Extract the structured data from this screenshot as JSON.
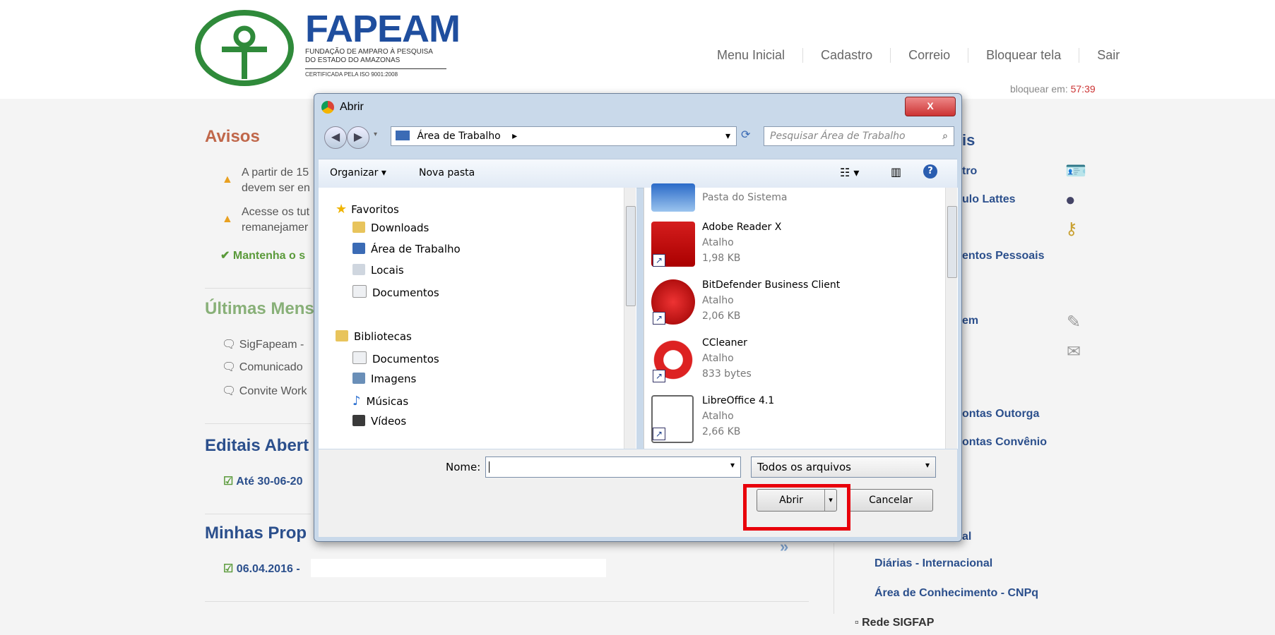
{
  "header": {
    "logo": {
      "title": "FAPEAM",
      "subtitle_line1": "FUNDAÇÃO DE AMPARO À PESQUISA",
      "subtitle_line2": "DO ESTADO DO AMAZONAS",
      "cert": "CERTIFICADA PELA ISO 9001:2008"
    },
    "nav": [
      "Menu Inicial",
      "Cadastro",
      "Correio",
      "Bloquear tela",
      "Sair"
    ],
    "timer_prefix": "bloquear em: ",
    "timer_value": "57:39"
  },
  "left": {
    "avisos_title": "Avisos",
    "avisos": [
      {
        "line1": "A partir de 15",
        "line2": "devem ser en"
      },
      {
        "line1": "Acesse os tut",
        "line2": "remanejamer"
      }
    ],
    "avisos_check": "Mantenha o s",
    "mensagens_title": "Últimas Mens",
    "mensagens": [
      "SigFapeam -",
      "Comunicado",
      "Convite Work"
    ],
    "editais_title": "Editais Abert",
    "editais_item": "Até 30-06-20",
    "propostas_title": "Minhas Prop",
    "propostas_item": "06.04.2016 -"
  },
  "right": {
    "title_fragment": "is",
    "links": [
      "tro",
      "ulo Lattes",
      "entos Pessoais",
      "em",
      "ontas Outorga",
      "ontas Convênio",
      "al",
      "Diárias - Internacional",
      "Área de Conhecimento - CNPq"
    ],
    "rede": "Rede SIGFAP"
  },
  "dialog": {
    "title": "Abrir",
    "close": "X",
    "address": "Área de Trabalho",
    "search_placeholder": "Pesquisar Área de Trabalho",
    "toolbar": {
      "organize": "Organizar",
      "new_folder": "Nova pasta"
    },
    "tree": {
      "favorites": "Favoritos",
      "fav_items": [
        "Downloads",
        "Área de Trabalho",
        "Locais",
        "Documentos"
      ],
      "libraries": "Bibliotecas",
      "lib_items": [
        "Documentos",
        "Imagens",
        "Músicas",
        "Vídeos"
      ]
    },
    "files": [
      {
        "name": "",
        "type": "Pasta do Sistema",
        "size": ""
      },
      {
        "name": "Adobe Reader X",
        "type": "Atalho",
        "size": "1,98 KB"
      },
      {
        "name": "BitDefender Business Client",
        "type": "Atalho",
        "size": "2,06 KB"
      },
      {
        "name": "CCleaner",
        "type": "Atalho",
        "size": "833 bytes"
      },
      {
        "name": "LibreOffice 4.1",
        "type": "Atalho",
        "size": "2,66 KB"
      }
    ],
    "filename_label": "Nome:",
    "filename_value": "",
    "filter": "Todos os arquivos",
    "open_button": "Abrir",
    "cancel_button": "Cancelar"
  },
  "colors": {
    "brand_blue": "#1f4e9e",
    "brand_green": "#2f8a3a",
    "highlight_red": "#e8000b"
  }
}
